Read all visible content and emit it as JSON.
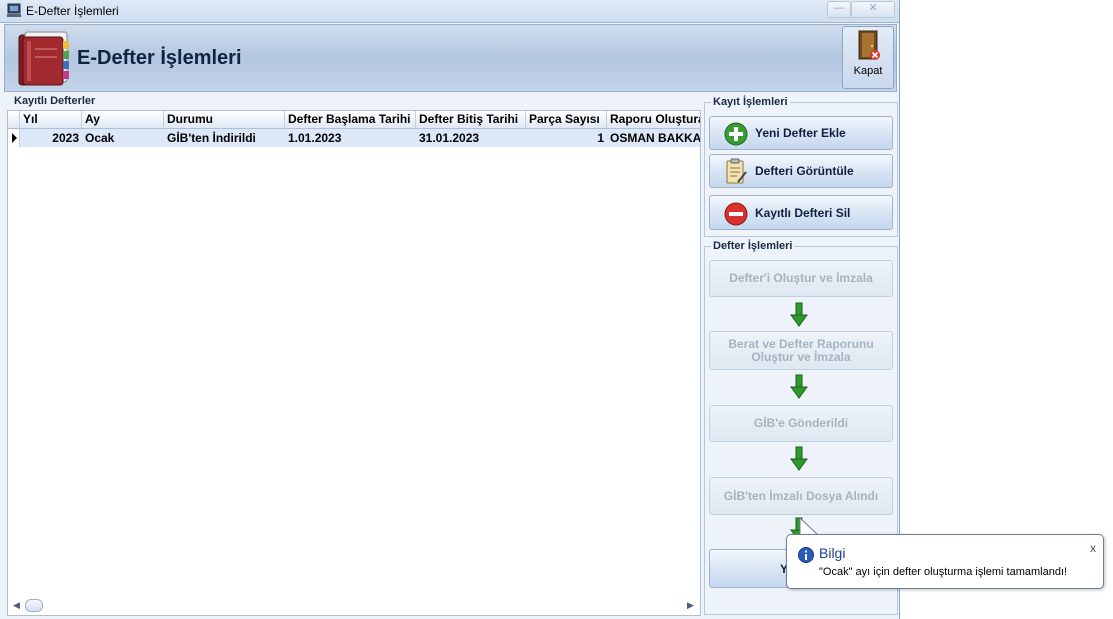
{
  "window": {
    "title": "E-Defter İşlemleri",
    "minimize_label": "—",
    "close_label": "✕"
  },
  "header": {
    "title": "E-Defter İşlemleri",
    "close_button_label": "Kapat"
  },
  "ledgers": {
    "group_label": "Kayıtlı Defterler",
    "columns": [
      "Yıl",
      "Ay",
      "Durumu",
      "Defter Başlama Tarihi",
      "Defter Bitiş Tarihi",
      "Parça Sayısı",
      "Raporu Oluştura"
    ],
    "rows": [
      {
        "year": "2023",
        "month": "Ocak",
        "status": "GİB'ten İndirildi",
        "start_date": "1.01.2023",
        "end_date": "31.01.2023",
        "part_count": "1",
        "report_creator": "OSMAN BAKKAL"
      }
    ]
  },
  "record_ops": {
    "group_label": "Kayıt İşlemleri",
    "new_ledger": "Yeni Defter Ekle",
    "view_ledger": "Defteri Görüntüle",
    "delete_ledger": "Kayıtlı Defteri Sil"
  },
  "ledger_ops": {
    "group_label": "Defter İşlemleri",
    "step1": "Defter'i Oluştur ve İmzala",
    "step2": "Berat ve Defter Raporunu Oluştur ve İmzala",
    "step3": "GİB'e Gönderildi",
    "step4": "GİB'ten İmzalı Dosya Alındı",
    "step5_partial": "Y"
  },
  "tooltip": {
    "title": "Bilgi",
    "message": "\"Ocak\" ayı için defter oluşturma işlemi tamamlandı!",
    "close": "x"
  },
  "colors": {
    "accent": "#1e3f8f",
    "header_bg": "#b3c7e0",
    "selected_row": "#dce7f7"
  }
}
